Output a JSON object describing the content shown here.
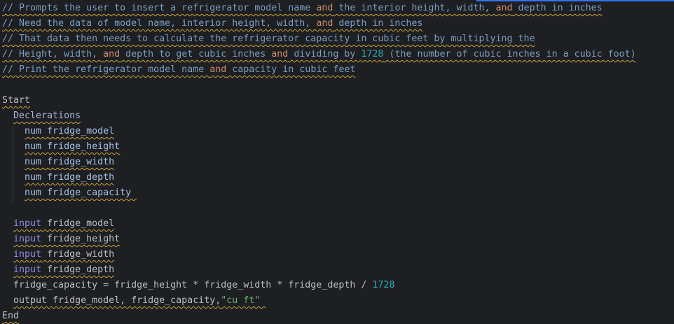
{
  "editor": {
    "accent_color": "#3574f0",
    "lines": [
      {
        "underline": true,
        "tokens": [
          [
            "comment",
            "// Prompts the user to insert a refrigerator model name "
          ],
          [
            "kw",
            "and"
          ],
          [
            "comment",
            " the interior height, width, "
          ],
          [
            "kw",
            "and"
          ],
          [
            "comment",
            " depth in inches"
          ]
        ]
      },
      {
        "underline": true,
        "tokens": [
          [
            "comment",
            "// Need the data of model name, interior height, width, "
          ],
          [
            "kw",
            "and"
          ],
          [
            "comment",
            " depth in inches"
          ]
        ]
      },
      {
        "underline": true,
        "tokens": [
          [
            "comment",
            "// That data then needs to calculate the refrigerator capacity in cubic feet by multiplying the"
          ]
        ]
      },
      {
        "underline": true,
        "tokens": [
          [
            "comment",
            "// Height, width, "
          ],
          [
            "kw",
            "and"
          ],
          [
            "comment",
            " depth to get cubic inches "
          ],
          [
            "kw",
            "and"
          ],
          [
            "comment",
            " dividing by "
          ],
          [
            "num",
            "1728"
          ],
          [
            "comment",
            " (the number of cubic inches in a cubic foot)"
          ]
        ]
      },
      {
        "underline": true,
        "tokens": [
          [
            "comment",
            "// Print the refrigerator model name "
          ],
          [
            "kw",
            "and"
          ],
          [
            "comment",
            " capacity in cubic feet"
          ]
        ]
      },
      {
        "underline": false,
        "tokens": []
      },
      {
        "underline": true,
        "tokens": [
          [
            "plain",
            "Start"
          ]
        ]
      },
      {
        "underline": true,
        "indent": "  ",
        "tokens": [
          [
            "decl",
            "Declerations"
          ]
        ]
      },
      {
        "underline": true,
        "indent": "    ",
        "tokens": [
          [
            "var",
            "num fridge_model"
          ]
        ]
      },
      {
        "underline": true,
        "indent": "    ",
        "tokens": [
          [
            "var",
            "num fridge_height"
          ]
        ]
      },
      {
        "underline": true,
        "indent": "    ",
        "tokens": [
          [
            "var",
            "num fridge_width"
          ]
        ]
      },
      {
        "underline": true,
        "indent": "    ",
        "tokens": [
          [
            "var",
            "num fridge_depth"
          ]
        ]
      },
      {
        "underline": true,
        "indent": "    ",
        "tokens": [
          [
            "var",
            "num fridge_capacity "
          ]
        ]
      },
      {
        "underline": false,
        "tokens": []
      },
      {
        "underline": true,
        "indent": "  ",
        "tokens": [
          [
            "input",
            "input"
          ],
          [
            "plain",
            " fridge_model"
          ]
        ]
      },
      {
        "underline": true,
        "indent": "  ",
        "tokens": [
          [
            "input",
            "input"
          ],
          [
            "plain",
            " fridge_height"
          ]
        ]
      },
      {
        "underline": true,
        "indent": "  ",
        "tokens": [
          [
            "input",
            "input"
          ],
          [
            "plain",
            " fridge_width"
          ]
        ]
      },
      {
        "underline": true,
        "indent": "  ",
        "tokens": [
          [
            "input",
            "input"
          ],
          [
            "plain",
            " fridge_depth"
          ]
        ]
      },
      {
        "underline": false,
        "indent": "  ",
        "tokens": [
          [
            "plain",
            "fridge_capacity = fridge_height * fridge_width * fridge_depth / "
          ],
          [
            "num",
            "1728"
          ]
        ]
      },
      {
        "underline": true,
        "indent": "  ",
        "tokens": [
          [
            "plain",
            "output fridge_model, fridge_capacity,"
          ],
          [
            "str",
            "\"cu ft\""
          ],
          [
            "plain",
            " "
          ]
        ]
      },
      {
        "underline": true,
        "tokens": [
          [
            "plain",
            "End"
          ]
        ]
      }
    ]
  }
}
